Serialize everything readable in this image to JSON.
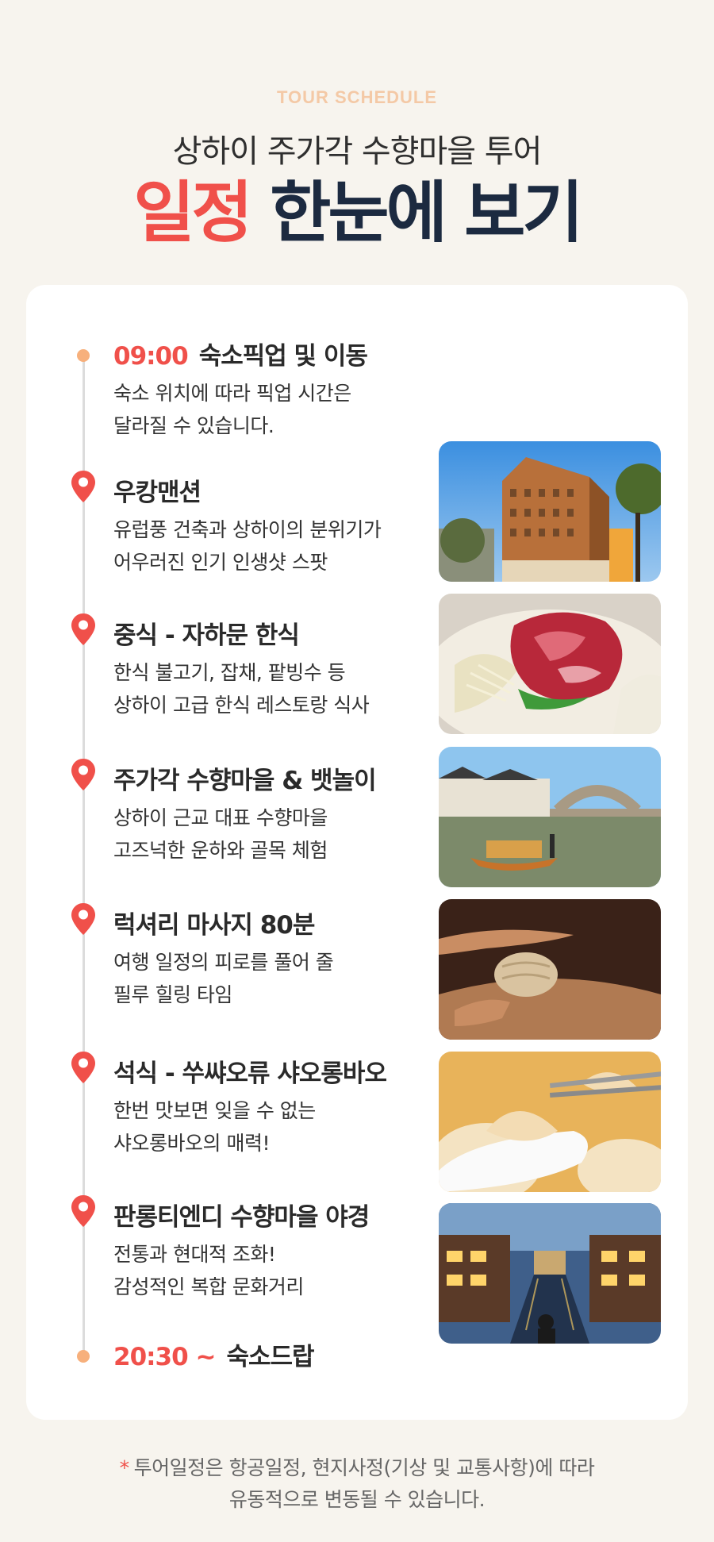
{
  "header": {
    "eyebrow": "TOUR SCHEDULE",
    "subtitle": "상하이 주가각 수향마을 투어",
    "headline_accent": "일정",
    "headline_rest": " 한눈에 보기"
  },
  "schedule": [
    {
      "time": "09:00",
      "title": "숙소픽업 및 이동",
      "desc": [
        "숙소 위치에 따라 픽업 시간은",
        "달라질 수 있습니다."
      ]
    },
    {
      "title": "우캉맨션",
      "desc": [
        "유럽풍 건축과 상하이의 분위기가",
        "어우러진 인기 인생샷 스팟"
      ]
    },
    {
      "title": "중식 - 자하문 한식",
      "desc": [
        "한식 불고기, 잡채, 팥빙수 등",
        "상하이 고급 한식 레스토랑 식사"
      ]
    },
    {
      "title": "주가각 수향마을 & 뱃놀이",
      "desc": [
        "상하이 근교 대표 수향마을",
        "고즈넉한 운하와 골목 체험"
      ]
    },
    {
      "title": "럭셔리 마사지 80분",
      "desc": [
        "여행 일정의 피로를 풀어 줄",
        "필루 힐링 타임"
      ]
    },
    {
      "title": "석식 - 쑤쌰오류 샤오롱바오",
      "desc": [
        "한번 맛보면 잊을 수 없는",
        "샤오롱바오의 매력!"
      ]
    },
    {
      "title": "판롱티엔디 수향마을 야경",
      "desc": [
        "전통과 현대적 조화!",
        "감성적인 복합 문화거리"
      ]
    },
    {
      "time": "20:30 ~",
      "title": "숙소드랍"
    }
  ],
  "footnote": {
    "mark": "*",
    "line1": "투어일정은 항공일정, 현지사정(기상 및 교통사항)에 따라",
    "line2": "유동적으로 변동될 수 있습니다."
  },
  "colors": {
    "accent": "#f0504a",
    "navy": "#1c2a40",
    "dot": "#f7b07c",
    "eyebrow": "#f4c9a6",
    "background": "#f7f4ee"
  }
}
